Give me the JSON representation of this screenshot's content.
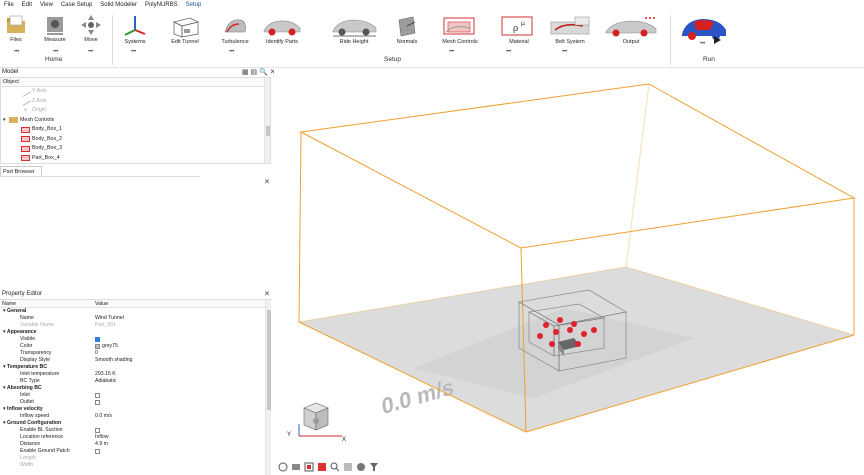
{
  "menu": [
    "File",
    "Edit",
    "View",
    "Case Setup",
    "Solid Modeler",
    "PolyNURBS",
    "Setup"
  ],
  "ribbon": {
    "tools": [
      "Files",
      "Measure",
      "Move",
      "Systems",
      "Edit Tunnel",
      "Turbulence",
      "Identify Parts",
      "Ride Height",
      "Normals",
      "Mesh Controls",
      "Material",
      "Belt System",
      "Output",
      "Run"
    ],
    "groups": {
      "home": "Home",
      "setup": "Setup",
      "run": "Run"
    }
  },
  "model_panel": {
    "title": "Model",
    "column_header": "Object",
    "items": [
      "Y Axis",
      "Z Axis",
      "Origin",
      "Mesh Controls",
      "Body_Box_1",
      "Body_Box_2",
      "Body_Box_3",
      "Part_Box_4"
    ]
  },
  "part_browser": {
    "tab": "Part Browser"
  },
  "property_editor": {
    "title": "Property Editor",
    "col_name": "Name",
    "col_value": "Value",
    "rows": [
      {
        "k": "General",
        "v": ""
      },
      {
        "k": "Name",
        "v": "Wind Tunnel"
      },
      {
        "k": "Variable Name",
        "v": "Part_551"
      },
      {
        "k": "Appearance",
        "v": ""
      },
      {
        "k": "Visible",
        "v": ""
      },
      {
        "k": "Color",
        "v": "grey75"
      },
      {
        "k": "Transparency",
        "v": "0"
      },
      {
        "k": "Display Style",
        "v": "Smooth shading"
      },
      {
        "k": "Temperature BC",
        "v": ""
      },
      {
        "k": "Inlet temperature",
        "v": "293.15 K"
      },
      {
        "k": "BC Type",
        "v": "Adiabatic"
      },
      {
        "k": "Absorbing BC",
        "v": ""
      },
      {
        "k": "Inlet",
        "v": ""
      },
      {
        "k": "Outlet",
        "v": ""
      },
      {
        "k": "Inflow velocity",
        "v": ""
      },
      {
        "k": "Inflow speed",
        "v": "0.0 m/s"
      },
      {
        "k": "Ground Configuration",
        "v": ""
      },
      {
        "k": "Enable BL Suction",
        "v": ""
      },
      {
        "k": "Location reference",
        "v": "Inflow"
      },
      {
        "k": "Distance",
        "v": "4.9 m"
      },
      {
        "k": "Enable Ground Patch",
        "v": ""
      },
      {
        "k": "Length",
        "v": ""
      },
      {
        "k": "Width",
        "v": ""
      }
    ]
  },
  "viewport": {
    "ground_text": "0.0 m/s",
    "axis_x": "X",
    "axis_y": "Y",
    "colors": {
      "tunnel_edge": "#f0a030",
      "ground": "#d9d9d9",
      "marker": "#e0202a"
    }
  }
}
